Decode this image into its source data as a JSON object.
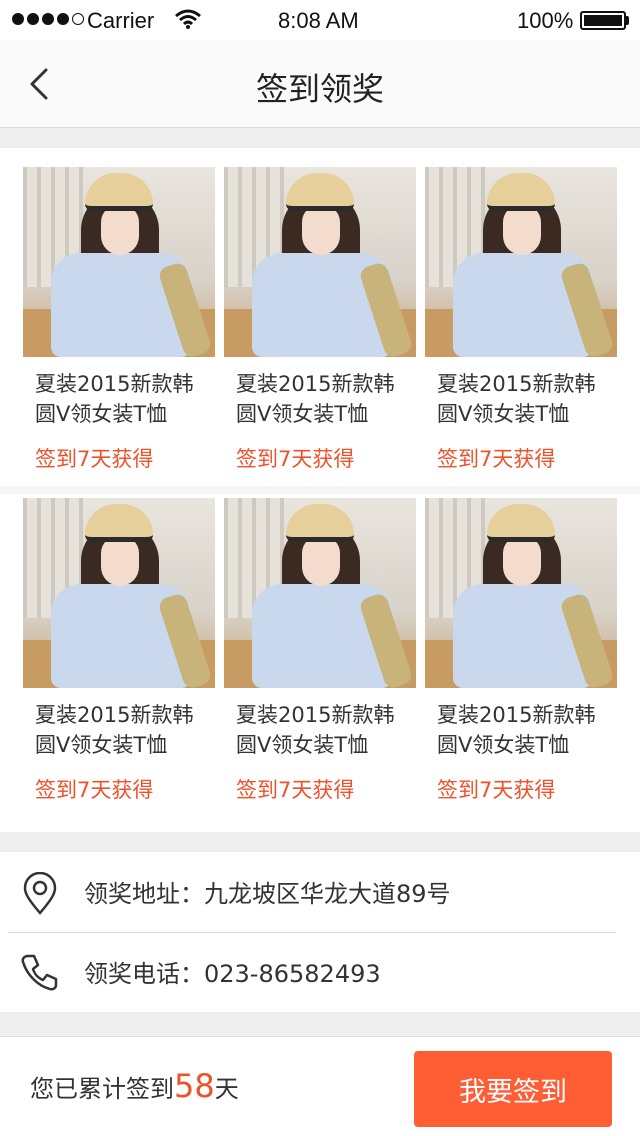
{
  "status_bar": {
    "carrier": "Carrier",
    "time": "8:08 AM",
    "battery": "100%",
    "icons": [
      "signal-dots-icon",
      "wifi-icon",
      "battery-icon"
    ]
  },
  "nav": {
    "title": "签到领奖",
    "back_icon": "chevron-left-icon"
  },
  "products": [
    {
      "title": "夏装2015新款韩圆V领女装T恤",
      "reward": "签到7天获得"
    },
    {
      "title": "夏装2015新款韩圆V领女装T恤",
      "reward": "签到7天获得"
    },
    {
      "title": "夏装2015新款韩圆V领女装T恤",
      "reward": "签到7天获得"
    },
    {
      "title": "夏装2015新款韩圆V领女装T恤",
      "reward": "签到7天获得"
    },
    {
      "title": "夏装2015新款韩圆V领女装T恤",
      "reward": "签到7天获得"
    },
    {
      "title": "夏装2015新款韩圆V领女装T恤",
      "reward": "签到7天获得"
    }
  ],
  "info": {
    "address": {
      "icon": "location-pin-icon",
      "text": "领奖地址：九龙坡区华龙大道89号"
    },
    "phone": {
      "icon": "phone-icon",
      "text": "领奖电话：023-86582493"
    }
  },
  "footer": {
    "summary_prefix": "您已累计签到",
    "days": "58",
    "summary_suffix": "天",
    "button_label": "我要签到"
  },
  "colors": {
    "accent": "#ff5e35",
    "reward_text": "#f0502a",
    "background": "#efefef"
  }
}
